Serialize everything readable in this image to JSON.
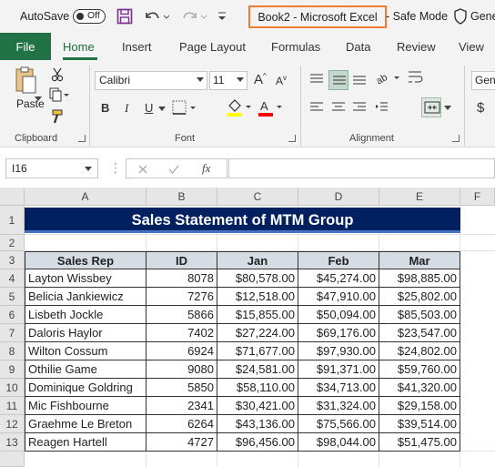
{
  "titlebar": {
    "autosave_label": "AutoSave",
    "autosave_state": "Off",
    "doc_title": "Book2  -  Microsoft Excel",
    "safe_mode": "- Safe Mode",
    "account_partial": "Gene"
  },
  "tabs": [
    "File",
    "Home",
    "Insert",
    "Page Layout",
    "Formulas",
    "Data",
    "Review",
    "View"
  ],
  "active_tab": "Home",
  "ribbon": {
    "paste_label": "Paste",
    "font_name": "Calibri",
    "font_size": "11",
    "number_format_partial": "Gen",
    "groups": [
      "Clipboard",
      "Font",
      "Alignment"
    ]
  },
  "formula_bar": {
    "name_box": "I16",
    "fx": "fx",
    "formula": ""
  },
  "columns": [
    "A",
    "B",
    "C",
    "D",
    "E",
    "F"
  ],
  "rows": [
    "1",
    "2",
    "3",
    "4",
    "5",
    "6",
    "7",
    "8",
    "9",
    "10",
    "11",
    "12",
    "13"
  ],
  "sheet": {
    "title": "Sales Statement of MTM Group",
    "headers": [
      "Sales Rep",
      "ID",
      "Jan",
      "Feb",
      "Mar"
    ],
    "data": [
      [
        "Layton Wissbey",
        "8078",
        "$80,578.00",
        "$45,274.00",
        "$98,885.00"
      ],
      [
        "Belicia Jankiewicz",
        "7276",
        "$12,518.00",
        "$47,910.00",
        "$25,802.00"
      ],
      [
        "Lisbeth Jockle",
        "5866",
        "$15,855.00",
        "$50,094.00",
        "$85,503.00"
      ],
      [
        "Daloris Haylor",
        "7402",
        "$27,224.00",
        "$69,176.00",
        "$23,547.00"
      ],
      [
        "Wilton Cossum",
        "6924",
        "$71,677.00",
        "$97,930.00",
        "$24,802.00"
      ],
      [
        "Othilie Game",
        "9080",
        "$24,581.00",
        "$91,371.00",
        "$59,760.00"
      ],
      [
        "Dominique Goldring",
        "5850",
        "$58,110.00",
        "$34,713.00",
        "$41,320.00"
      ],
      [
        "Mic Fishbourne",
        "2341",
        "$30,421.00",
        "$31,324.00",
        "$29,158.00"
      ],
      [
        "Graehme Le Breton",
        "6264",
        "$43,136.00",
        "$75,566.00",
        "$39,514.00"
      ],
      [
        "Reagen Hartell",
        "4727",
        "$96,456.00",
        "$98,044.00",
        "$51,475.00"
      ]
    ]
  },
  "colors": {
    "excel_green": "#217346",
    "title_fill": "#002060",
    "header_fill": "#d5dce4",
    "title_highlight": "#ed7d31"
  }
}
